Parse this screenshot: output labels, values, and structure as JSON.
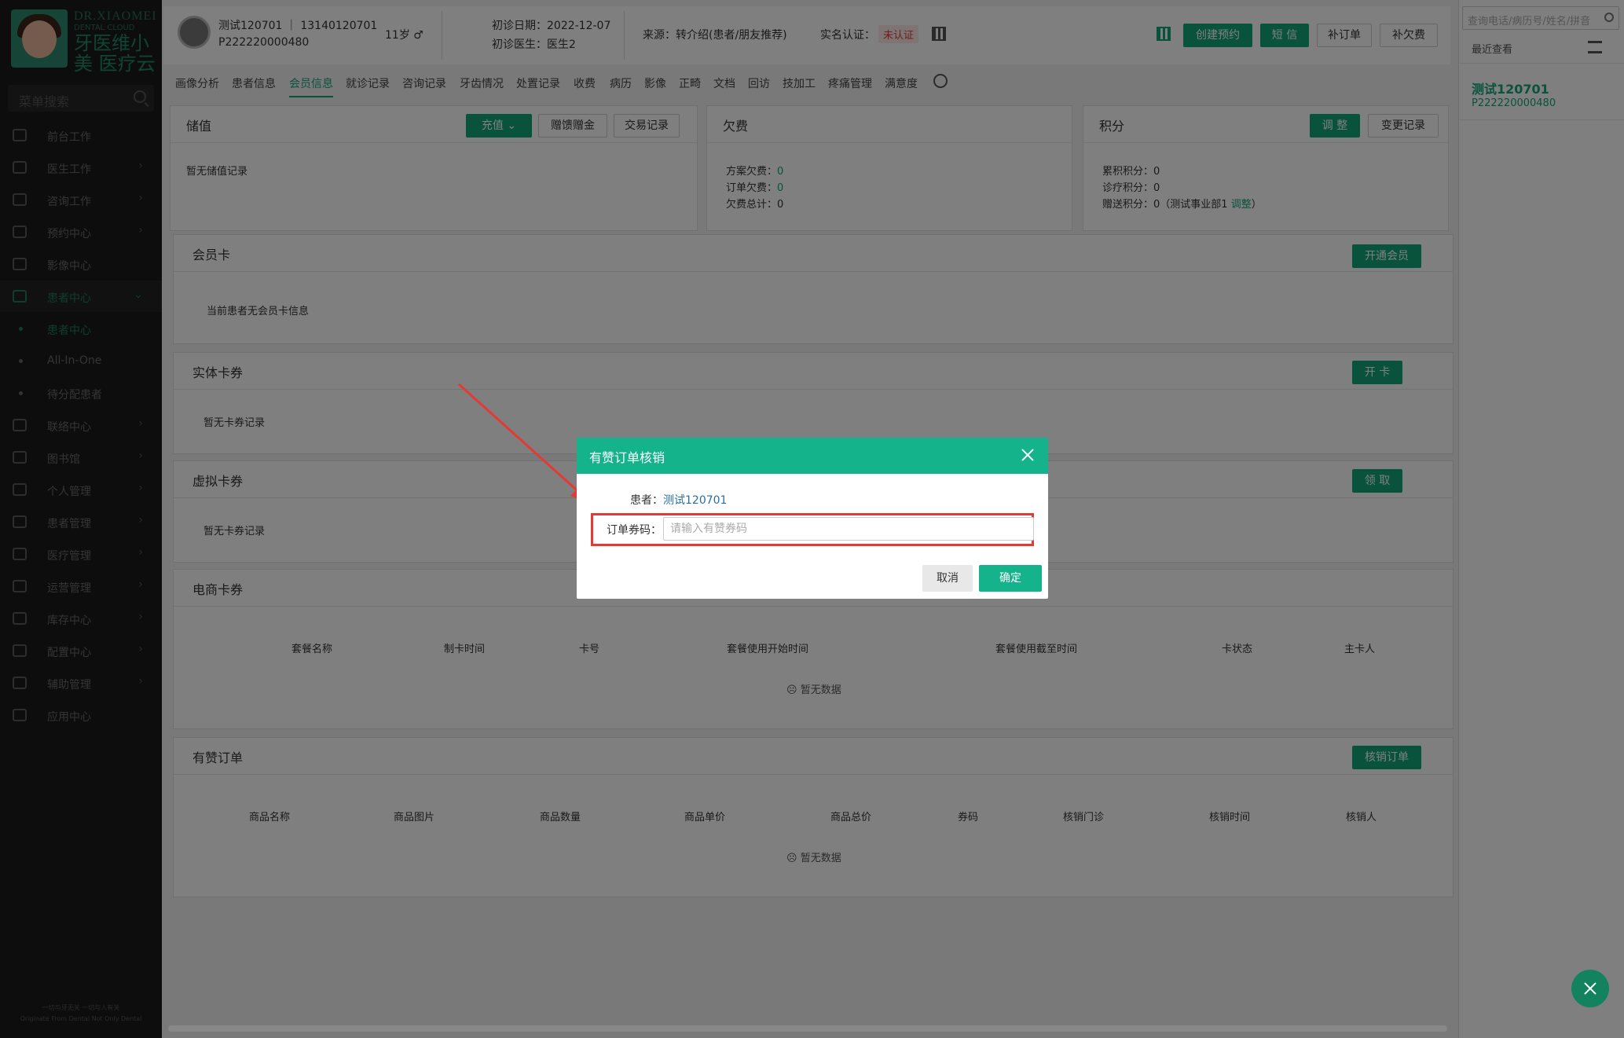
{
  "sidebar": {
    "logo_en": "DR.XIAOMEI",
    "logo_en2": "DENTAL CLOUD",
    "logo_cn": "牙医维小美 医疗云",
    "search_placeholder": "菜单搜索",
    "items": [
      {
        "label": "前台工作",
        "icon": "desk-icon"
      },
      {
        "label": "医生工作",
        "icon": "doctor-icon"
      },
      {
        "label": "咨询工作",
        "icon": "consult-icon"
      },
      {
        "label": "预约中心",
        "icon": "clock-icon"
      },
      {
        "label": "影像中心",
        "icon": "image-icon"
      },
      {
        "label": "患者中心",
        "icon": "patient-icon"
      },
      {
        "label": "患者中心"
      },
      {
        "label": "All-In-One"
      },
      {
        "label": "待分配患者"
      },
      {
        "label": "联络中心",
        "icon": "contact-icon"
      },
      {
        "label": "图书馆",
        "icon": "library-icon"
      },
      {
        "label": "个人管理",
        "icon": "person-icon"
      },
      {
        "label": "患者管理",
        "icon": "patients-manage-icon"
      },
      {
        "label": "医疗管理",
        "icon": "medical-icon"
      },
      {
        "label": "运营管理",
        "icon": "chart-icon"
      },
      {
        "label": "库存中心",
        "icon": "inventory-icon"
      },
      {
        "label": "配置中心",
        "icon": "config-icon"
      },
      {
        "label": "辅助管理",
        "icon": "assist-icon"
      },
      {
        "label": "应用中心",
        "icon": "apps-icon"
      }
    ],
    "footer1": "一切与牙无关 一切与人有关",
    "footer2": "Originate From Dental Not Only Dental"
  },
  "header": {
    "name_phone": "测试120701 ｜ 13140120701",
    "patient_id": "P222220000480",
    "age": "11岁 ♂",
    "first_visit_date": "初诊日期：2022-12-07",
    "first_doctor": "初诊医生：医生2",
    "source": "来源：转介绍(患者/朋友推荐)",
    "realname_label": "实名认证：",
    "realname_status": "未认证",
    "buttons": {
      "create_appt": "创建预约",
      "sms": "短 信",
      "add_order": "补订单",
      "add_debt": "补欠费"
    }
  },
  "tabs": [
    "画像分析",
    "患者信息",
    "会员信息",
    "就诊记录",
    "咨询记录",
    "牙齿情况",
    "处置记录",
    "收费",
    "病历",
    "影像",
    "正畸",
    "文档",
    "回访",
    "技加工",
    "疼痛管理",
    "满意度"
  ],
  "stored_value": {
    "title": "储值",
    "recharge": "充值",
    "gift": "赠馈赠金",
    "records": "交易记录",
    "empty": "暂无储值记录"
  },
  "debt": {
    "title": "欠费",
    "plan_label": "方案欠费：",
    "plan_value": "0",
    "order_label": "订单欠费：",
    "order_value": "0",
    "total_label": "欠费总计：",
    "total_value": "0"
  },
  "points": {
    "title": "积分",
    "adjust": "调 整",
    "change_log": "变更记录",
    "accum": "累积积分：0",
    "treat": "诊疗积分：0",
    "gift": "赠送积分：0（测试事业部1",
    "gift_link": "调整",
    "gift_end": "）"
  },
  "member_card": {
    "title": "会员卡",
    "button": "开通会员",
    "empty": "当前患者无会员卡信息"
  },
  "physical_card": {
    "title": "实体卡券",
    "button": "开 卡",
    "empty": "暂无卡券记录"
  },
  "virtual_card": {
    "title": "虚拟卡券",
    "button": "领 取",
    "empty": "暂无卡券记录"
  },
  "ecommerce": {
    "title": "电商卡券",
    "columns": [
      "套餐名称",
      "制卡时间",
      "卡号",
      "套餐使用开始时间",
      "套餐使用截至时间",
      "卡状态",
      "主卡人"
    ],
    "empty": "暂无数据"
  },
  "youzan": {
    "title": "有赞订单",
    "button": "核销订单",
    "columns": [
      "商品名称",
      "商品图片",
      "商品数量",
      "商品单价",
      "商品总价",
      "券码",
      "核销门诊",
      "核销时间",
      "核销人"
    ],
    "empty": "暂无数据"
  },
  "right_panel": {
    "search_placeholder": "查询电话/病历号/姓名/拼音",
    "recent": "最近查看",
    "recent_name": "测试120701",
    "recent_id": "P222220000480"
  },
  "modal": {
    "title": "有赞订单核销",
    "patient_label": "患者：",
    "patient_value": "测试120701",
    "code_label": "订单券码：",
    "code_placeholder": "请输入有赞券码",
    "code_value": "",
    "cancel": "取消",
    "ok": "确定"
  },
  "colors": {
    "accent": "#13a67b",
    "modal_header": "#14b38b",
    "highlight": "#e53935",
    "unauth": "#e03a3a"
  }
}
